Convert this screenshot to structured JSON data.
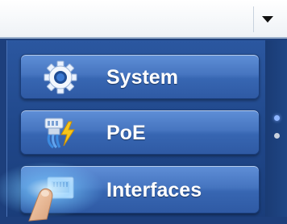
{
  "topbar": {
    "dropdown_value": "",
    "dropdown_icon": "triangle-down-icon"
  },
  "menu": {
    "items": [
      {
        "label": "System",
        "icon": "gear-icon"
      },
      {
        "label": "PoE",
        "icon": "poe-plug-lightning-icon"
      },
      {
        "label": "Interfaces",
        "icon": "ethernet-port-icon"
      }
    ]
  },
  "pagination": {
    "pages": 2,
    "current": 1
  },
  "colors": {
    "panel": "#1f4688",
    "button": "#4675c0",
    "label": "#ffffff",
    "dot_active": "#8fb6ff",
    "dot_inactive": "#c9d2de"
  }
}
